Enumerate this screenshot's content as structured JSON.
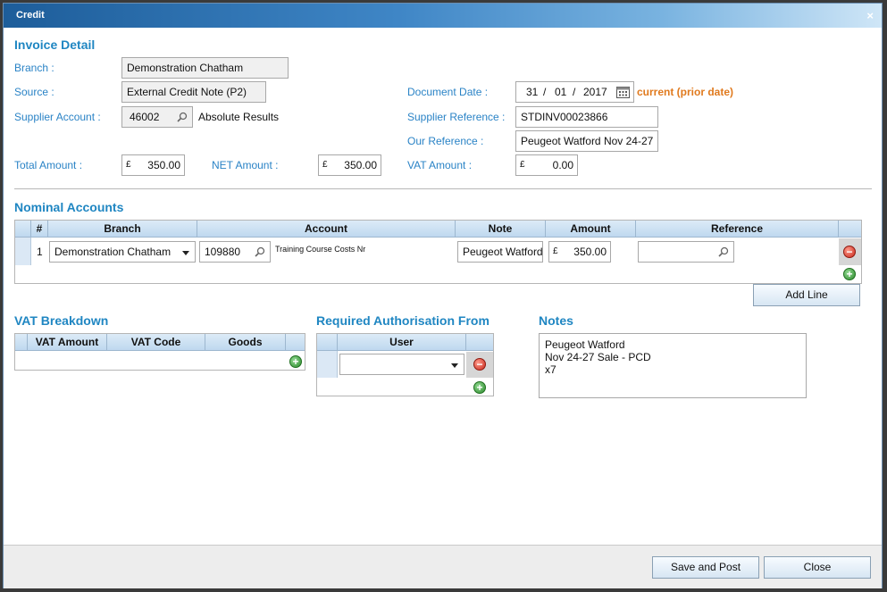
{
  "window": {
    "title": "Credit",
    "close_glyph": "×"
  },
  "invoice": {
    "heading": "Invoice Detail",
    "branch_label": "Branch :",
    "branch_value": "Demonstration Chatham",
    "source_label": "Source :",
    "source_value": "External Credit Note (P2)",
    "supplier_account_label": "Supplier Account :",
    "supplier_account_value": "46002",
    "supplier_name": "Absolute Results",
    "document_date_label": "Document Date :",
    "date_day": "31",
    "date_sep": "/",
    "date_month": "01",
    "date_year": "2017",
    "date_status": "current (prior date)",
    "supplier_reference_label": "Supplier Reference :",
    "supplier_reference_value": "STDINV00023866",
    "our_reference_label": "Our Reference :",
    "our_reference_value": "Peugeot Watford Nov 24-27",
    "total_amount_label": "Total Amount :",
    "total_amount_value": "350.00",
    "net_amount_label": "NET Amount :",
    "net_amount_value": "350.00",
    "vat_amount_label": "VAT Amount :",
    "vat_amount_value": "0.00",
    "currency_symbol": "£"
  },
  "nominal": {
    "heading": "Nominal Accounts",
    "columns": [
      "#",
      "Branch",
      "Account",
      "Note",
      "Amount",
      "Reference"
    ],
    "rows": [
      {
        "num": "1",
        "branch": "Demonstration Chatham",
        "account": "109880",
        "account_desc": "Training Course Costs Nr",
        "note": "Peugeot Watford",
        "amount": "350.00",
        "reference": ""
      }
    ],
    "add_line_label": "Add Line"
  },
  "vat": {
    "heading": "VAT Breakdown",
    "columns": [
      "VAT Amount",
      "VAT Code",
      "Goods"
    ]
  },
  "authorisation": {
    "heading": "Required Authorisation From",
    "columns": [
      "User"
    ],
    "user_value": ""
  },
  "notes": {
    "heading": "Notes",
    "lines": [
      "Peugeot Watford",
      "Nov 24-27 Sale - PCD",
      "x7"
    ]
  },
  "footer": {
    "save_post_label": "Save and Post",
    "close_label": "Close"
  },
  "colors": {
    "accent": "#1f86c2",
    "label": "#2a83c6",
    "warning": "#e07a1e"
  }
}
